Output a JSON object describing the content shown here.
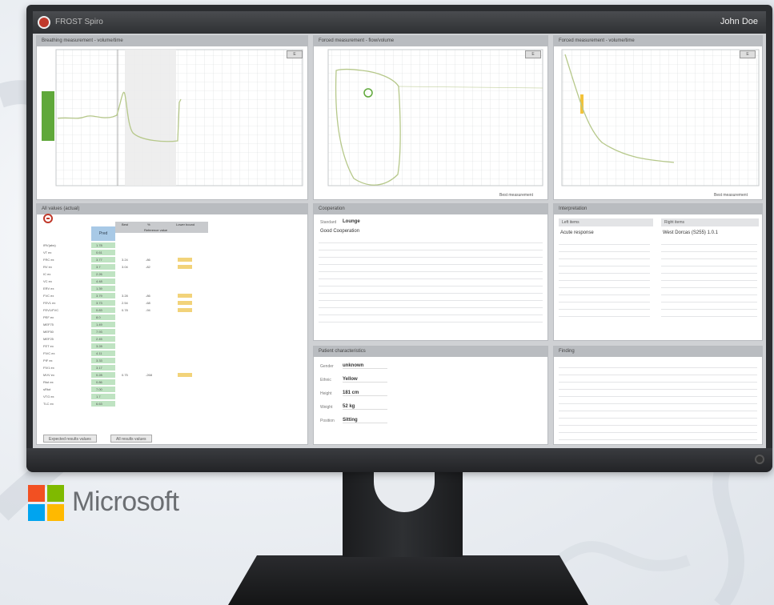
{
  "app": {
    "name": "FROST Spiro",
    "user": "John Doe"
  },
  "panels": {
    "breathing": {
      "title": "Breathing measurement - volume/time",
      "button": "E"
    },
    "flow_volume": {
      "title": "Forced measurement - flow/volume",
      "button": "E",
      "legend": "Best measurement"
    },
    "volume_time": {
      "title": "Forced measurement - volume/time",
      "button": "E",
      "legend": "Best measurement"
    },
    "all_values": {
      "title": "All values (actual)",
      "col_pred": "Pred",
      "col_best": "Best",
      "col_pct": "%",
      "col_lln": "Lower bound",
      "reference_label": "Reference value",
      "tabs": [
        "Expected results values",
        "All results values"
      ]
    },
    "cooperation": {
      "title": "Cooperation",
      "label": "Standard",
      "value": "Lounge",
      "comment": "Good Cooperation"
    },
    "interpretation": {
      "title": "Interpretation",
      "left_head": "Left items",
      "right_head": "Right items",
      "left_value": "Acute response",
      "right_value": "West Dorcas (S255) 1.0.1"
    },
    "patient": {
      "title": "Patient characteristics",
      "fields": [
        {
          "label": "Gender",
          "value": "unknown"
        },
        {
          "label": "Ethnic",
          "value": "Yellow"
        },
        {
          "label": "Height",
          "value": "181 cm"
        },
        {
          "label": "Weight",
          "value": "52 kg"
        },
        {
          "label": "Position",
          "value": "Sitting"
        }
      ]
    },
    "finding": {
      "title": "Finding"
    }
  },
  "table_rows": [
    {
      "name": "IRV(abs)",
      "pred": "1.78"
    },
    {
      "name": "VT ex",
      "pred": "0.61"
    },
    {
      "name": "FRC ex",
      "pred": "3.77",
      "best": "3.24",
      "pct": "-86",
      "flag": true
    },
    {
      "name": "RV ex",
      "pred": "3.7",
      "best": "3.04",
      "pct": "-82",
      "flag": true
    },
    {
      "name": "IC ex",
      "pred": "2.26"
    },
    {
      "name": "VC ex",
      "pred": "4.48"
    },
    {
      "name": "ERV ex",
      "pred": "1.39"
    },
    {
      "name": "FVC ex",
      "pred": "3.79",
      "best": "3.28",
      "pct": "-86",
      "flag": true
    },
    {
      "name": "FEV1 ex",
      "pred": "3.73",
      "best": "2.54",
      "pct": "-68",
      "flag": true
    },
    {
      "name": "FEV1/FVC",
      "pred": "0.83",
      "best": "0.78",
      "pct": "-94",
      "flag": true
    },
    {
      "name": "PEF ex",
      "pred": "8.0"
    },
    {
      "name": "MEF75",
      "pred": "1.49"
    },
    {
      "name": "MEF50",
      "pred": "7.93"
    },
    {
      "name": "MEF25",
      "pred": "2.45"
    },
    {
      "name": "FET ex",
      "pred": "3.28"
    },
    {
      "name": "FIVC ex",
      "pred": "4.11"
    },
    {
      "name": "PIF ex",
      "pred": "3.33"
    },
    {
      "name": "FIV1 ex",
      "pred": "3.17"
    },
    {
      "name": "MVV ex",
      "pred": "0.28",
      "best": "0.75",
      "pct": "-268",
      "flag": true
    },
    {
      "name": "Rtot ex",
      "pred": "0.86"
    },
    {
      "name": "sRtot",
      "pred": "7.00"
    },
    {
      "name": "VTG ex",
      "pred": "1.7"
    },
    {
      "name": "TLC ex",
      "pred": "6.63"
    }
  ],
  "brand": {
    "text": "Microsoft"
  },
  "colors": {
    "ms_red": "#f25022",
    "ms_green": "#7fba00",
    "ms_blue": "#00a4ef",
    "ms_yellow": "#ffb900",
    "curve": "#b6c88a",
    "green_zone": "#5fa83a",
    "yellow_zone": "#f2c23a"
  }
}
